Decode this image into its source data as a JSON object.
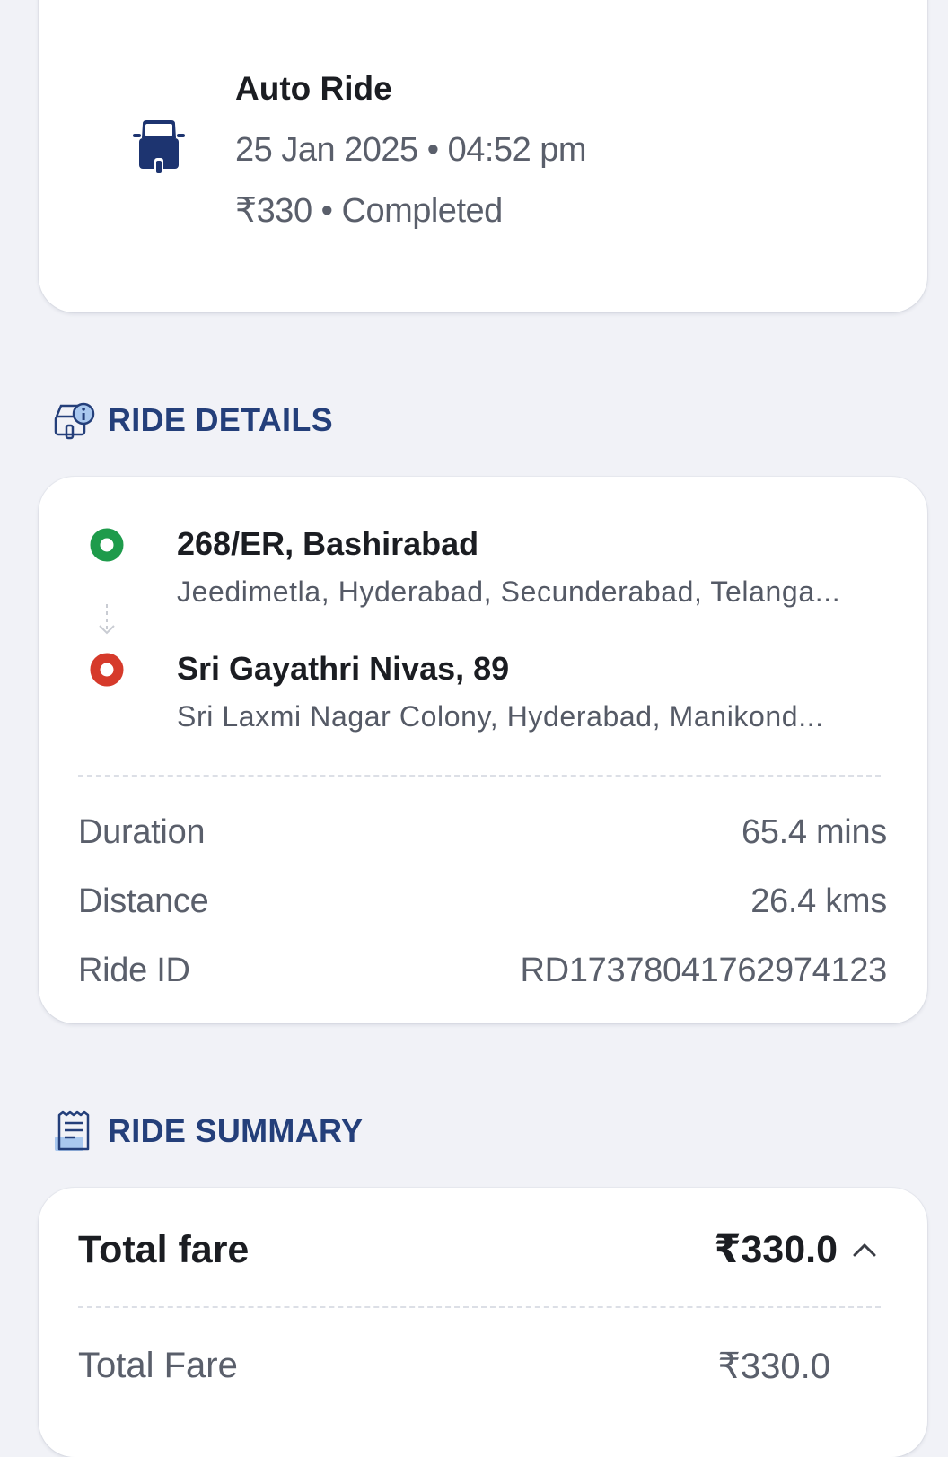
{
  "ride": {
    "title": "Auto Ride",
    "datetime": "25 Jan 2025 • 04:52 pm",
    "status": "₹330 • Completed",
    "icon": "auto-rickshaw-icon"
  },
  "ride_details": {
    "heading": "RIDE DETAILS",
    "icon": "ride-info-icon",
    "pickup": {
      "title": "268/ER, Bashirabad",
      "address": "Jeedimetla, Hyderabad, Secunderabad, Telanga...",
      "color": "#1e9b4b"
    },
    "drop": {
      "title": "Sri Gayathri Nivas, 89",
      "address": "Sri Laxmi Nagar Colony, Hyderabad, Manikond...",
      "color": "#d63a2b"
    },
    "rows": {
      "duration": {
        "label": "Duration",
        "value": "65.4 mins"
      },
      "distance": {
        "label": "Distance",
        "value": "26.4 kms"
      },
      "ride_id": {
        "label": "Ride ID",
        "value": "RD17378041762974123"
      }
    }
  },
  "ride_summary": {
    "heading": "RIDE SUMMARY",
    "icon": "receipt-icon",
    "total_fare_label": "Total fare",
    "total_fare_value": "₹330.0",
    "breakdown": {
      "label": "Total Fare",
      "value": "₹330.0"
    }
  },
  "colors": {
    "accent": "#243f7a",
    "background": "#f1f2f7",
    "card": "#ffffff"
  }
}
